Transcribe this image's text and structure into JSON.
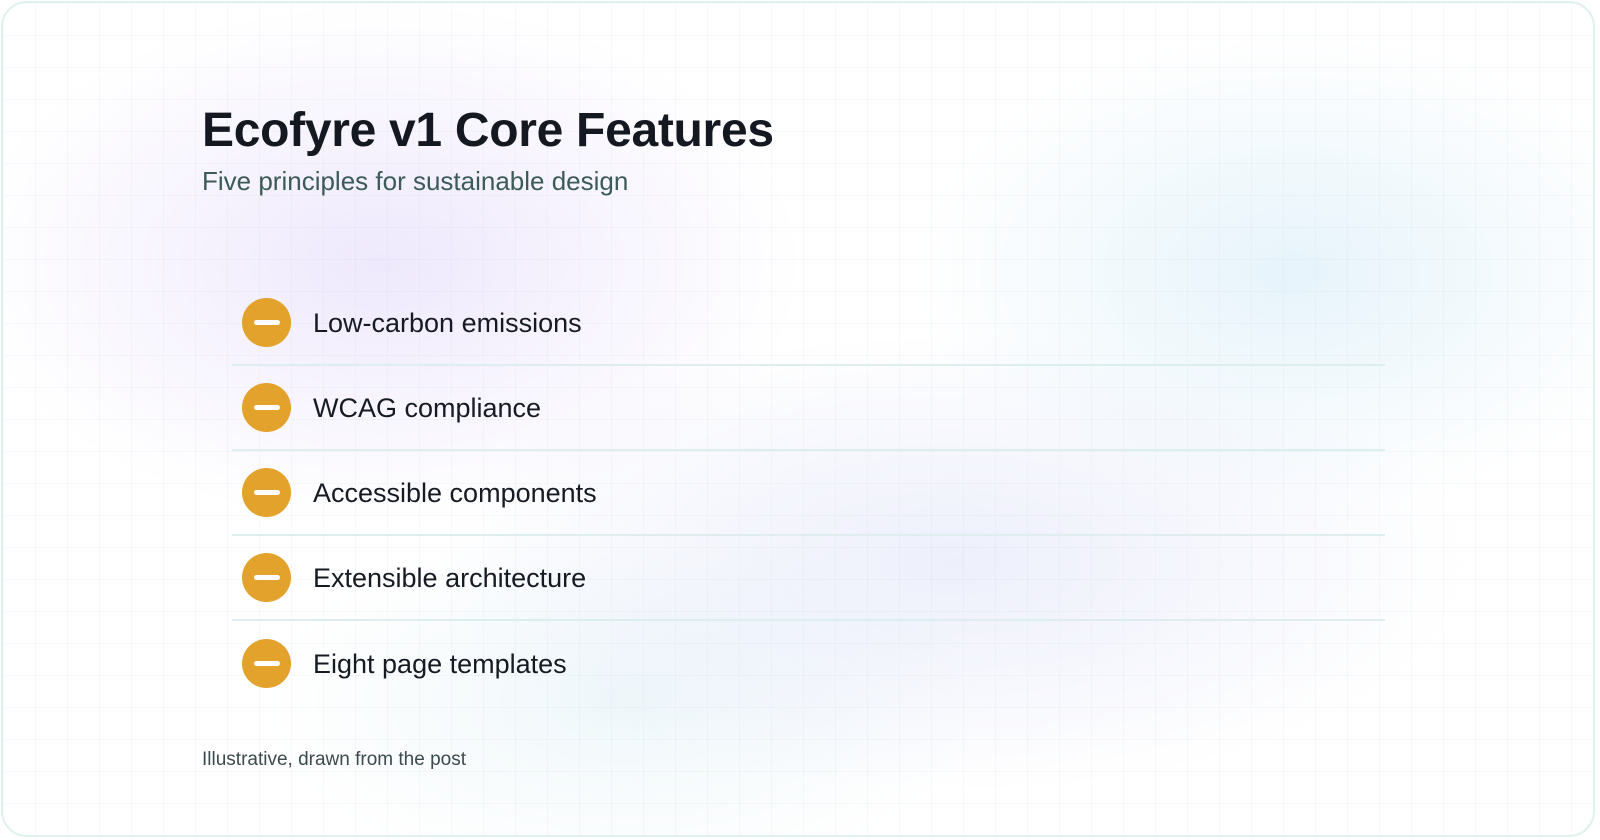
{
  "header": {
    "title": "Ecofyre v1 Core Features",
    "subtitle": "Five principles for sustainable design"
  },
  "features": [
    {
      "label": "Low-carbon emissions",
      "icon": "minus-circle-icon"
    },
    {
      "label": "WCAG compliance",
      "icon": "minus-circle-icon"
    },
    {
      "label": "Accessible components",
      "icon": "minus-circle-icon"
    },
    {
      "label": "Extensible architecture",
      "icon": "minus-circle-icon"
    },
    {
      "label": "Eight page templates",
      "icon": "minus-circle-icon"
    }
  ],
  "footnote": "Illustrative, drawn from the post",
  "colors": {
    "accent": "#e2a22b",
    "title": "#141821",
    "subtitle": "#3c5a5b",
    "divider": "#dcefee",
    "border": "#dff1ee"
  }
}
